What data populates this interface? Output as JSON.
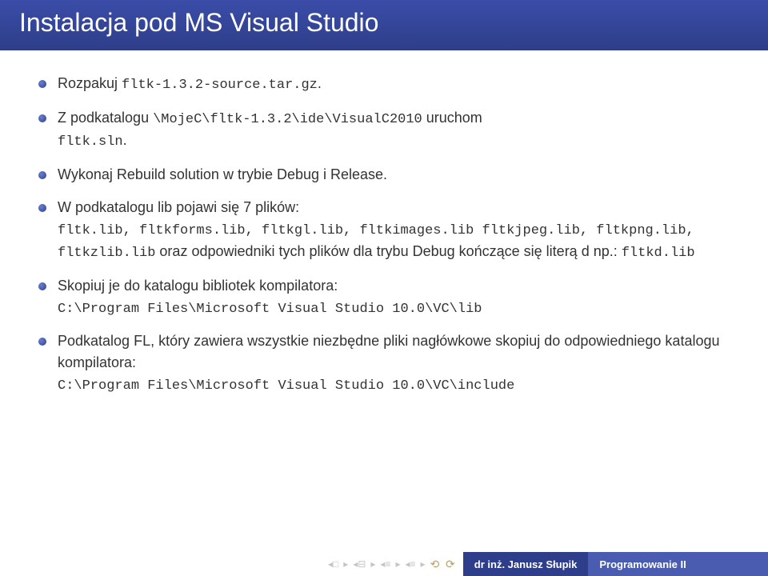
{
  "title": "Instalacja pod MS Visual Studio",
  "items": [
    {
      "pre": "Rozpakuj ",
      "code1": "fltk-1.3.2-source.tar.gz",
      "post": "."
    },
    {
      "pre": "Z podkatalogu ",
      "code1": "\\MojeC\\fltk-1.3.2\\ide\\VisualC2010",
      "mid1": " uruchom ",
      "code2": "fltk.sln",
      "post": "."
    },
    {
      "pre": "Wykonaj Rebuild solution w trybie Debug i Release."
    },
    {
      "pre": "W podkatalogu lib pojawi się 7 plików: ",
      "code1": "fltk.lib, fltkforms.lib, fltkgl.lib, fltkimages.lib fltkjpeg.lib, fltkpng.lib, fltkzlib.lib",
      "mid1": " oraz odpowiedniki tych plików dla trybu Debug kończące się literą d np.: ",
      "code2": "fltkd.lib"
    },
    {
      "pre": "Skopiuj je do katalogu bibliotek kompilatora: ",
      "code1": "C:\\Program Files\\Microsoft Visual Studio 10.0\\VC\\lib"
    },
    {
      "pre": "Podkatalog FL, który zawiera wszystkie niezbędne pliki nagłówkowe skopiuj do odpowiedniego katalogu kompilatora: ",
      "code1": "C:\\Program Files\\Microsoft Visual Studio 10.0\\VC\\include"
    }
  ],
  "footer": {
    "author": "dr inż. Janusz Słupik",
    "course": "Programowanie II"
  }
}
